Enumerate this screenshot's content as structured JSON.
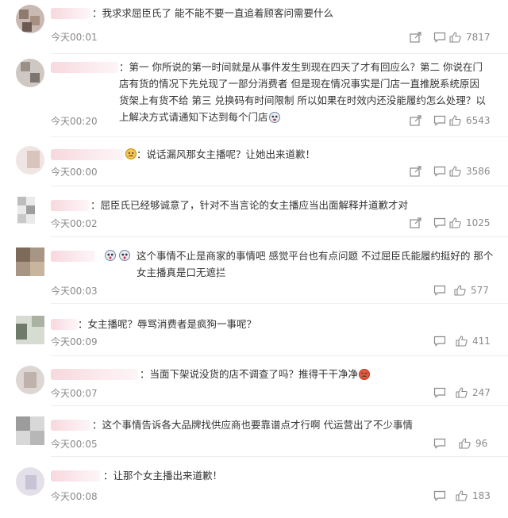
{
  "comments": [
    {
      "text": "：我求求屈臣氏了 能不能不要一直追着顾客问需要什么",
      "time": "今天00:01",
      "likes": "7817"
    },
    {
      "text": "：第一 你所说的第一时间就是从事件发生到现在四天了才有回应么？第二 你说在门店有货的情况下先兑现了一部分消费者 但是现在情况事实是门店一直推脱系统原因货架上有货不给 第三 兑换码有时间限制 所以如果在时效内还没能履约怎么处理？以上解决方式请通知下达到每个门店",
      "time": "今天00:20",
      "likes": "6543"
    },
    {
      "text": "：说话漏风那女主播呢？让她出来道歉！",
      "time": "今天00:00",
      "likes": "3586"
    },
    {
      "text": "：屈臣氏已经够诚意了，针对不当言论的女主播应当出面解释并道歉才对",
      "time": "今天00:02",
      "likes": "1025"
    },
    {
      "text": "这个事情不止是商家的事情吧 感觉平台也有点问题 不过屈臣氏能履约挺好的 那个女主播真是口无遮拦",
      "time": "今天00:03",
      "likes": "577"
    },
    {
      "text": "：女主播呢？辱骂消费者是疯狗一事呢？",
      "time": "今天00:09",
      "likes": "411"
    },
    {
      "text": "：当面下架说没货的店不调查了吗？推得干干净净",
      "time": "今天00:07",
      "likes": "247"
    },
    {
      "text": "：这个事情告诉各大品牌找供应商也要靠谱点才行啊 代运营出了不少事情",
      "time": "今天00:05",
      "likes": "96"
    },
    {
      "text": "：让那个女主播出来道歉！",
      "time": "今天00:08",
      "likes": "183"
    }
  ],
  "icons": {
    "share": "share-icon",
    "comment": "comment-icon",
    "like": "thumbs-up-icon"
  },
  "colors": {
    "text": "#333333",
    "meta": "#8a8a8a",
    "blur_name": "#f7d8de"
  }
}
